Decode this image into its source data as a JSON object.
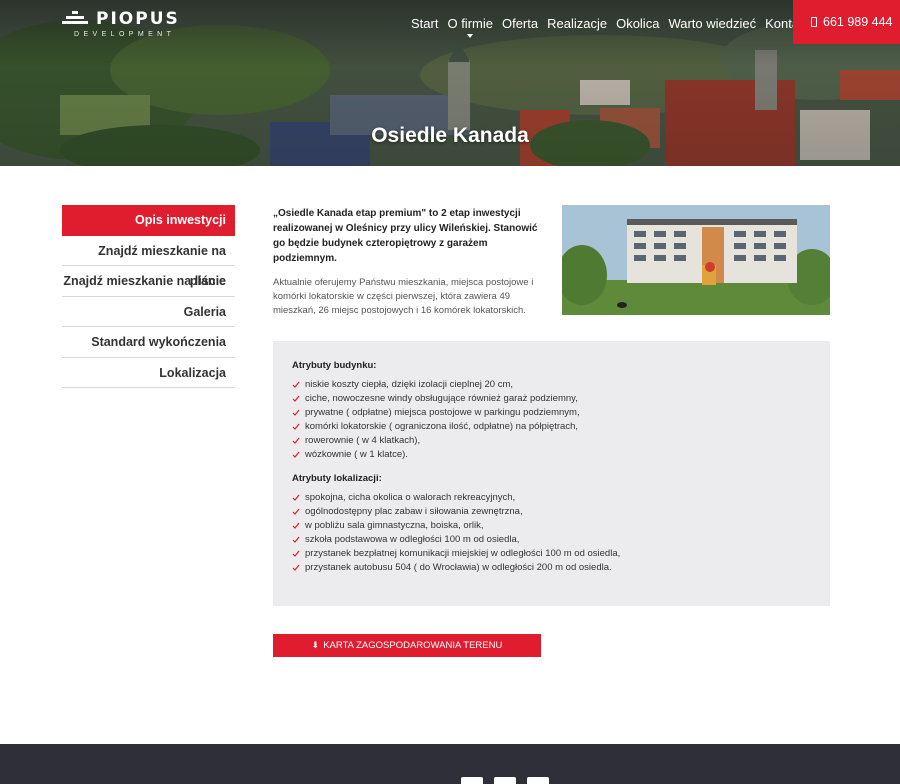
{
  "brand": {
    "name": "PIOPUS",
    "sub": "DEVELOPMENT"
  },
  "nav": {
    "items": [
      {
        "label": "Start"
      },
      {
        "label": "O firmie"
      },
      {
        "label": "Oferta"
      },
      {
        "label": "Realizacje"
      },
      {
        "label": "Okolica"
      },
      {
        "label": "Warto wiedzieć"
      },
      {
        "label": "Kontakt"
      }
    ],
    "phone": "661 989 444"
  },
  "hero": {
    "title": "Osiedle Kanada"
  },
  "sidebar": {
    "items": [
      {
        "label": "Opis inwestycji"
      },
      {
        "label": "Znajdź mieszkanie na planie"
      },
      {
        "label": "Znajdź mieszkanie na liście"
      },
      {
        "label": "Galeria"
      },
      {
        "label": "Standard wykończenia"
      },
      {
        "label": "Lokalizacja"
      }
    ]
  },
  "intro": {
    "lead": "„Osiedle Kanada etap premium\" to 2 etap inwestycji realizowanej w Oleśnicy przy ulicy Wileńskiej. Stanowić go będzie budynek czteropiętrowy z garażem podziemnym.",
    "body": "Aktualnie oferujemy Państwu mieszkania, miejsca postojowe i komórki lokatorskie w części pierwszej, która zawiera 49 mieszkań, 26 miejsc postojowych i 16 komórek lokatorskich."
  },
  "attributes": {
    "building_title": "Atrybuty budynku:",
    "building": [
      "niskie koszty ciepła, dzięki izolacji cieplnej 20 cm,",
      "ciche, nowoczesne windy obsługujące również garaż podziemny,",
      "prywatne ( odpłatne) miejsca postojowe w parkingu podziemnym,",
      "komórki lokatorskie ( ograniczona ilość, odpłatne) na półpiętrach,",
      "rowerownie ( w 4 klatkach),",
      "wózkownie ( w 1 klatce)."
    ],
    "location_title": "Atrybuty lokalizacji:",
    "location": [
      "spokojna, cicha okolica o walorach rekreacyjnych,",
      "ogólnodostępny plac zabaw i siłowania zewnętrzna,",
      "w pobliżu sala gimnastyczna, boiska, orlik,",
      "szkoła podstawowa w odległości 100 m od osiedla,",
      "przystanek bezpłatnej komunikacji miejskiej w odległości 100 m od osiedla,",
      "przystanek autobusu 504 ( do Wrocławia) w odległości 200 m od osiedla."
    ]
  },
  "download": {
    "label": "KARTA ZAGOSPODAROWANIA TERENU"
  },
  "colors": {
    "accent": "#e01c2f",
    "footer": "#2e2f38",
    "box": "#ececee"
  }
}
